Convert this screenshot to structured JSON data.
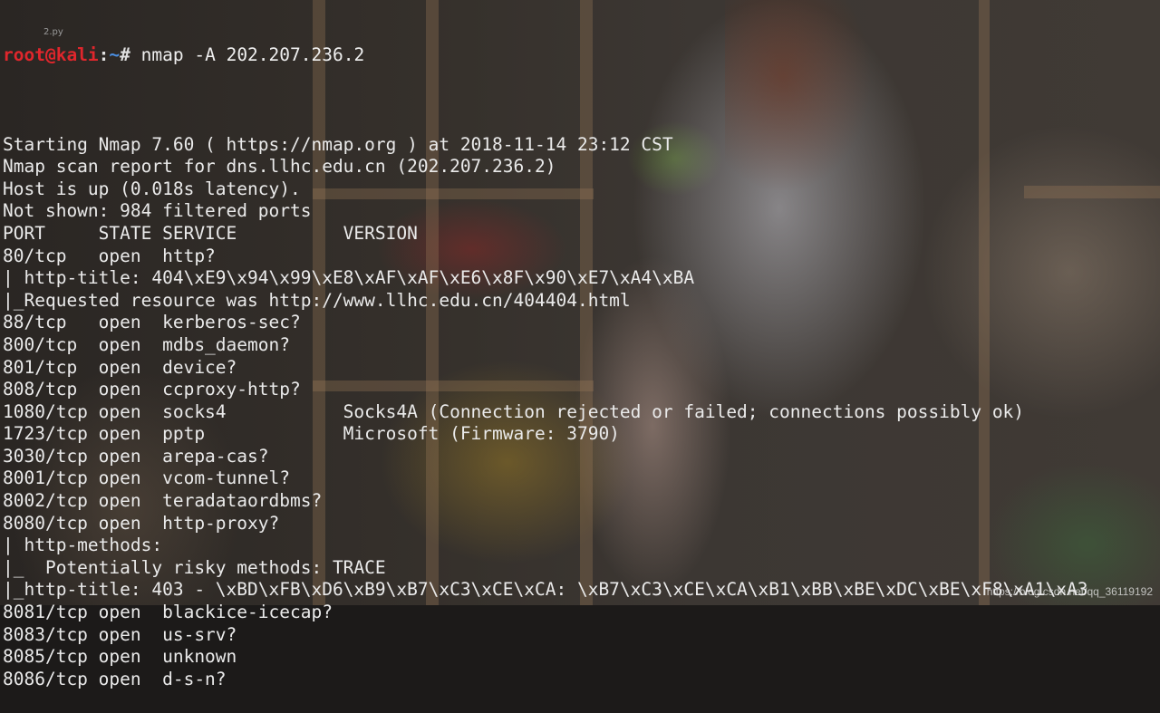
{
  "prompt": {
    "user_host": "root@kali",
    "separator": ":",
    "path": "~",
    "symbol": "# ",
    "command": "nmap -A 202.207.236.2"
  },
  "desktop_icon_label": "2.py",
  "output_lines": [
    "",
    "Starting Nmap 7.60 ( https://nmap.org ) at 2018-11-14 23:12 CST",
    "Nmap scan report for dns.llhc.edu.cn (202.207.236.2)",
    "Host is up (0.018s latency).",
    "Not shown: 984 filtered ports",
    "PORT     STATE SERVICE          VERSION",
    "80/tcp   open  http?",
    "| http-title: 404\\xE9\\x94\\x99\\xE8\\xAF\\xAF\\xE6\\x8F\\x90\\xE7\\xA4\\xBA",
    "|_Requested resource was http://www.llhc.edu.cn/404404.html",
    "88/tcp   open  kerberos-sec?",
    "800/tcp  open  mdbs_daemon?",
    "801/tcp  open  device?",
    "808/tcp  open  ccproxy-http?",
    "1080/tcp open  socks4           Socks4A (Connection rejected or failed; connections possibly ok)",
    "1723/tcp open  pptp             Microsoft (Firmware: 3790)",
    "3030/tcp open  arepa-cas?",
    "8001/tcp open  vcom-tunnel?",
    "8002/tcp open  teradataordbms?",
    "8080/tcp open  http-proxy?",
    "| http-methods:",
    "|_  Potentially risky methods: TRACE",
    "|_http-title: 403 - \\xBD\\xFB\\xD6\\xB9\\xB7\\xC3\\xCE\\xCA: \\xB7\\xC3\\xCE\\xCA\\xB1\\xBB\\xBE\\xDC\\xBE\\xF8\\xA1\\xA3",
    "8081/tcp open  blackice-icecap?",
    "8083/tcp open  us-srv?",
    "8085/tcp open  unknown",
    "8086/tcp open  d-s-n?"
  ],
  "watermark": "https://blog.csdn.net/qq_36119192"
}
